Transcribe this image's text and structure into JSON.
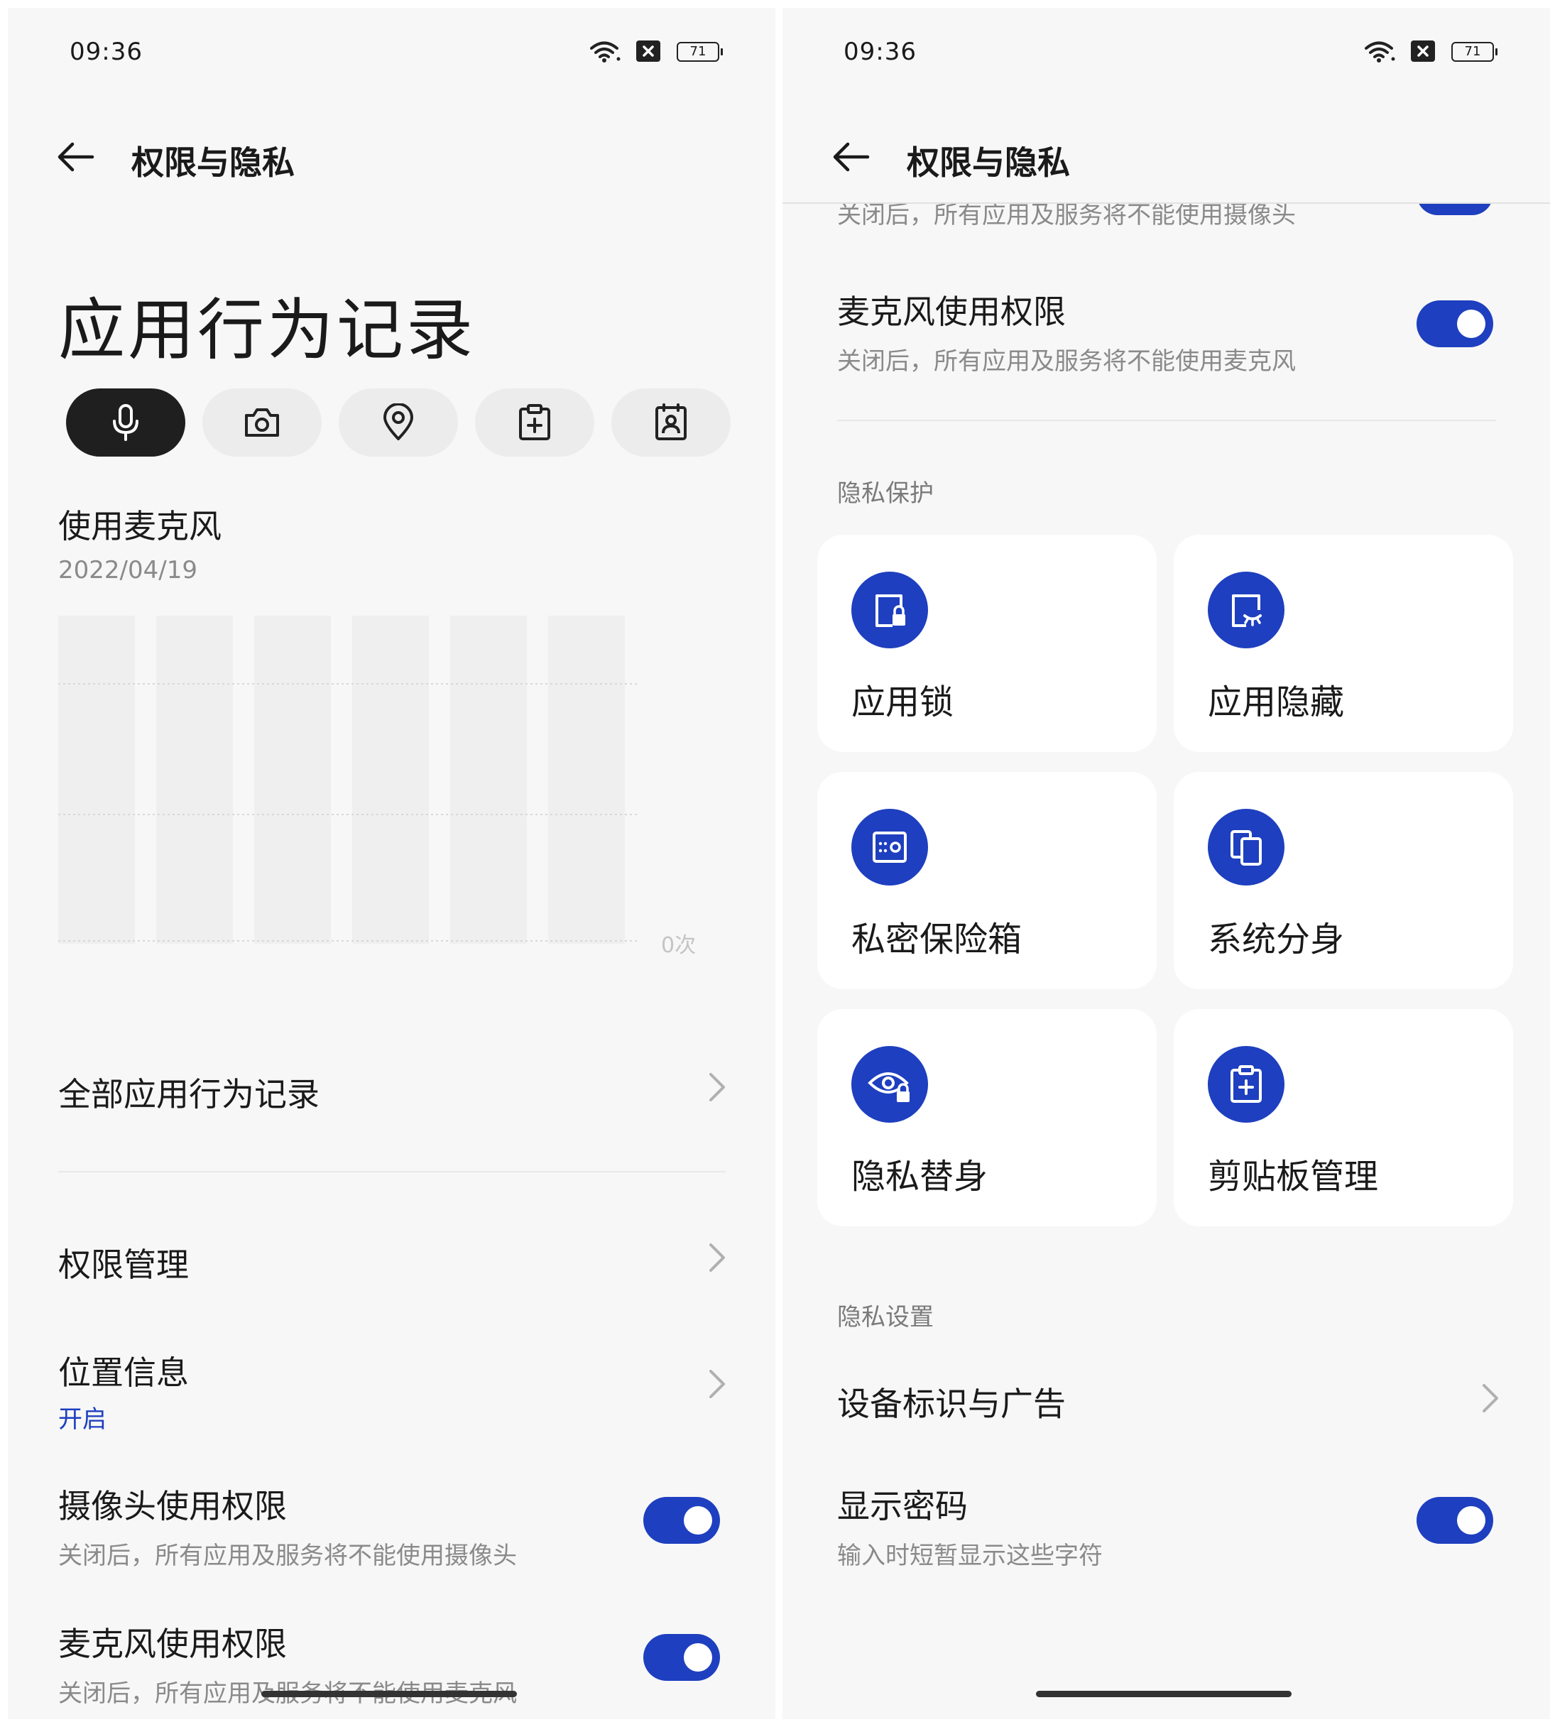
{
  "left": {
    "status": {
      "time": "09:36",
      "battery": "71"
    },
    "header": {
      "title": "权限与隐私"
    },
    "page_title": "应用行为记录",
    "chips": [
      {
        "icon": "microphone-icon",
        "active": true
      },
      {
        "icon": "camera-icon",
        "active": false
      },
      {
        "icon": "location-pin-icon",
        "active": false
      },
      {
        "icon": "clipboard-icon",
        "active": false
      },
      {
        "icon": "contacts-icon",
        "active": false
      }
    ],
    "usage": {
      "title": "使用麦克风",
      "date": "2022/04/19",
      "axis_label": "0次"
    },
    "rows": {
      "all_records": "全部应用行为记录",
      "permission_manage": "权限管理",
      "location": {
        "title": "位置信息",
        "status": "开启"
      },
      "camera_perm": {
        "title": "摄像头使用权限",
        "desc": "关闭后，所有应用及服务将不能使用摄像头"
      },
      "mic_perm": {
        "title": "麦克风使用权限",
        "desc": "关闭后，所有应用及服务将不能使用麦克风"
      }
    }
  },
  "right": {
    "status": {
      "time": "09:36",
      "battery": "71"
    },
    "header": {
      "title": "权限与隐私"
    },
    "clipped_desc": "关闭后，所有应用及服务将不能使用摄像头",
    "mic_perm": {
      "title": "麦克风使用权限",
      "desc": "关闭后，所有应用及服务将不能使用麦克风"
    },
    "privacy_protection": {
      "label": "隐私保护",
      "cards": [
        {
          "label": "应用锁",
          "icon": "app-lock-icon"
        },
        {
          "label": "应用隐藏",
          "icon": "app-hide-icon"
        },
        {
          "label": "私密保险箱",
          "icon": "safe-box-icon"
        },
        {
          "label": "系统分身",
          "icon": "system-clone-icon"
        },
        {
          "label": "隐私替身",
          "icon": "privacy-eye-lock-icon"
        },
        {
          "label": "剪贴板管理",
          "icon": "clipboard-plus-icon"
        }
      ]
    },
    "privacy_settings": {
      "label": "隐私设置",
      "device_id": "设备标识与广告",
      "show_password": {
        "title": "显示密码",
        "desc": "输入时短暂显示这些字符"
      }
    }
  },
  "colors": {
    "accent": "#1e3fbf",
    "background": "#f7f7f7",
    "chip_active": "#1f1f1f"
  }
}
